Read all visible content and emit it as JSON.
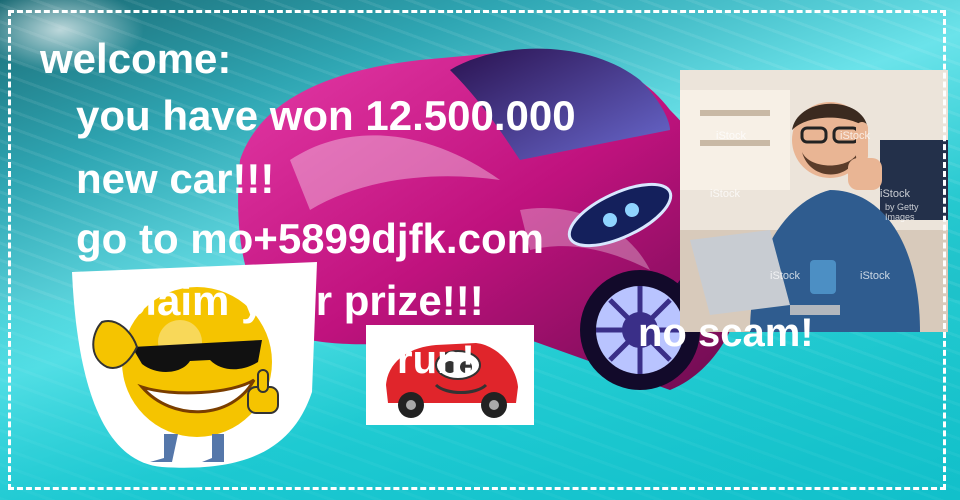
{
  "banner": {
    "welcome": "welcome:",
    "line1": "you have won 12.500.000",
    "line2": "new car!!!",
    "line3": "go to mo+5899djfk.com",
    "line4": "claim your prize!!!",
    "no_scam": "no scam!",
    "sticker_label": "run!"
  },
  "photo": {
    "watermark": "iStock",
    "credit": "by Getty Images"
  },
  "colors": {
    "text": "#ffffff",
    "car_body": "#c0127e",
    "sticker_car": "#e0252b",
    "smiley": "#f5c400"
  },
  "icons": [
    "smiley-sunglasses-icon",
    "cartoon-car-icon",
    "sports-car-image",
    "man-thumbs-up-photo"
  ]
}
